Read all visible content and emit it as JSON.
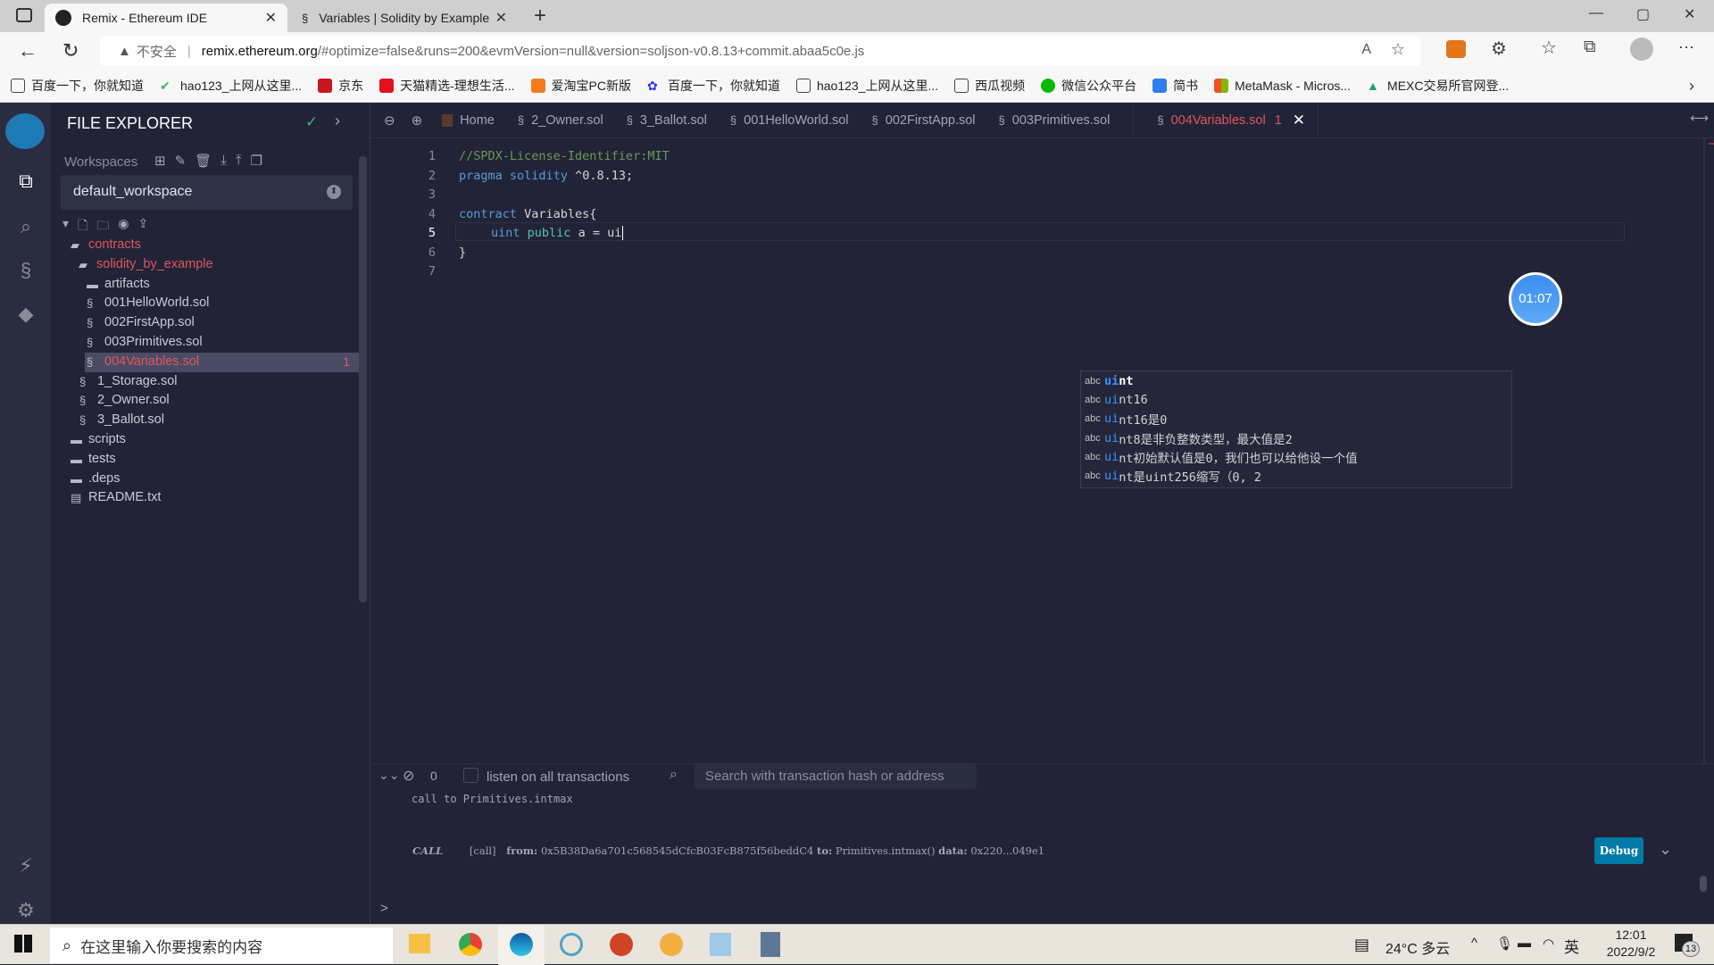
{
  "browser": {
    "tabs": [
      {
        "title": "Remix - Ethereum IDE",
        "active": true
      },
      {
        "title": "Variables | Solidity by Example | (",
        "active": false
      }
    ],
    "new_tab": "+",
    "security_label": "不安全",
    "url_host": "remix.ethereum.org",
    "url_rest": "/#optimize=false&runs=200&evmVersion=null&version=soljson-v0.8.13+commit.abaa5c0e.js",
    "bookmarks": [
      "百度一下，你就知道",
      "hao123_上网从这里...",
      "京东",
      "天猫精选-理想生活...",
      "爱淘宝PC新版",
      "百度一下，你就知道",
      "hao123_上网从这里...",
      "西瓜视频",
      "微信公众平台",
      "简书",
      "MetaMask - Micros...",
      "MEXC交易所官网登..."
    ],
    "window_controls": {
      "minimize": "—",
      "maximize": "▢",
      "close": "✕"
    },
    "more": "···"
  },
  "explorer": {
    "title": "FILE EXPLORER",
    "workspaces_label": "Workspaces",
    "workspace_selected": "default_workspace",
    "tree": [
      {
        "name": "contracts",
        "type": "folder-open",
        "level": 0,
        "modified": true
      },
      {
        "name": "solidity_by_example",
        "type": "folder-open",
        "level": 1,
        "modified": true
      },
      {
        "name": "artifacts",
        "type": "folder",
        "level": 2
      },
      {
        "name": "001HelloWorld.sol",
        "type": "sol",
        "level": 2
      },
      {
        "name": "002FirstApp.sol",
        "type": "sol",
        "level": 2
      },
      {
        "name": "003Primitives.sol",
        "type": "sol",
        "level": 2
      },
      {
        "name": "004Variables.sol",
        "type": "sol",
        "level": 2,
        "selected": true,
        "badge": "1"
      },
      {
        "name": "1_Storage.sol",
        "type": "sol",
        "level": 1
      },
      {
        "name": "2_Owner.sol",
        "type": "sol",
        "level": 1
      },
      {
        "name": "3_Ballot.sol",
        "type": "sol",
        "level": 1
      },
      {
        "name": "scripts",
        "type": "folder",
        "level": 0
      },
      {
        "name": "tests",
        "type": "folder",
        "level": 0
      },
      {
        "name": ".deps",
        "type": "folder",
        "level": 0
      },
      {
        "name": "README.txt",
        "type": "file",
        "level": 0
      }
    ]
  },
  "editor": {
    "tabs": [
      {
        "label": "Home",
        "icon": "home"
      },
      {
        "label": "2_Owner.sol",
        "icon": "sol"
      },
      {
        "label": "3_Ballot.sol",
        "icon": "sol"
      },
      {
        "label": "001HelloWorld.sol",
        "icon": "sol"
      },
      {
        "label": "002FirstApp.sol",
        "icon": "sol"
      },
      {
        "label": "003Primitives.sol",
        "icon": "sol"
      },
      {
        "label": "004Variables.sol",
        "icon": "sol",
        "active": true,
        "badge": "1"
      }
    ],
    "lines": [
      "1",
      "2",
      "3",
      "4",
      "5",
      "6",
      "7"
    ],
    "code": {
      "l1": "//SPDX-License-Identifier:MIT",
      "l2_kw1": "pragma",
      "l2_kw2": "solidity",
      "l2_rest": " ^0.8.13;",
      "l4_kw": "contract",
      "l4_rest": " Variables{",
      "l5_type": "uint",
      "l5_kw": "public",
      "l5_rest": " a = ui",
      "l6": "}"
    },
    "suggestions": [
      {
        "kind": "abc",
        "match": "ui",
        "rest": "nt"
      },
      {
        "kind": "abc",
        "match": "ui",
        "rest": "nt16"
      },
      {
        "kind": "abc",
        "match": "ui",
        "rest": "nt16是0"
      },
      {
        "kind": "abc",
        "match": "ui",
        "rest": "nt8是非负整数类型，最大值是2"
      },
      {
        "kind": "abc",
        "match": "ui",
        "rest": "nt初始默认值是0，我们也可以给他设一个值"
      },
      {
        "kind": "abc",
        "match": "ui",
        "rest": "nt是uint256缩写（0, 2"
      }
    ],
    "timer": "01:07"
  },
  "terminal": {
    "count": "0",
    "listen_label": "listen on all transactions",
    "search_placeholder": "Search with transaction hash or address",
    "log_line": "call to Primitives.intmax",
    "call_tag": "CALL",
    "call_type": "[call]",
    "from_label": "from:",
    "from_addr": "0x5B38Da6a701c568545dCfcB03FcB875f56beddC4",
    "to_label": "to:",
    "to_value": "Primitives.intmax()",
    "data_label": "data:",
    "data_value": "0x220...049e1",
    "debug_label": "Debug",
    "prompt": ">"
  },
  "taskbar": {
    "search_placeholder": "在这里输入你要搜索的内容",
    "weather": "24°C 多云",
    "ime": "英",
    "time": "12:01",
    "date": "2022/9/2",
    "notifications": "13"
  },
  "colors": {
    "accent": "#007aa6",
    "modified": "#e0565b",
    "bg": "#222336",
    "keyword": "#569cd6",
    "comment": "#6a9955",
    "public_kw": "#4ec9b0"
  }
}
